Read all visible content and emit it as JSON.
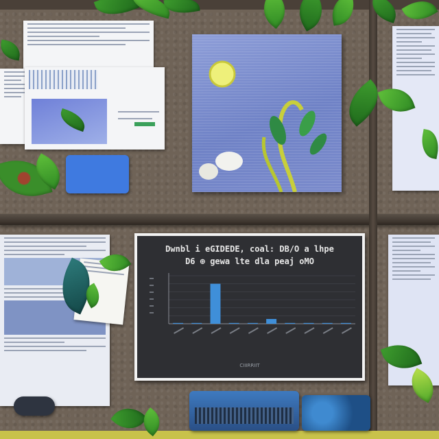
{
  "scene": {
    "description_colors": {
      "board": "#6f6357",
      "shelf": "#3e362f",
      "poster_blue": "#7b8bcc",
      "chart_bg": "#2e2f33",
      "leaf_green": "#3e9c2e",
      "accent_yellow": "#c8c24a"
    }
  },
  "chart": {
    "title_line1": "Dwnbl i eGIDEDE, coal: DB/O a lhpe",
    "title_line2": "D6 ⊕ gewa lte dla peaj oMO",
    "xlabel": "CIIIRRIIT"
  },
  "chart_data": {
    "type": "bar",
    "title": "Dwnbl i eGIDEDE, coal: DB/O a lhpe D6 ⊕ gewa lte dla peaj oMO",
    "xlabel": "CIIIRRIIT",
    "ylabel": "",
    "categories": [
      "",
      "",
      "",
      "",
      "",
      "",
      "",
      "",
      "",
      ""
    ],
    "values": [
      0.2,
      0.2,
      10,
      0.2,
      0.2,
      1.2,
      0.2,
      0.2,
      0.2,
      0.2
    ],
    "ylim": [
      0,
      12
    ],
    "grid": true,
    "bar_color": "#3f8fd9"
  }
}
